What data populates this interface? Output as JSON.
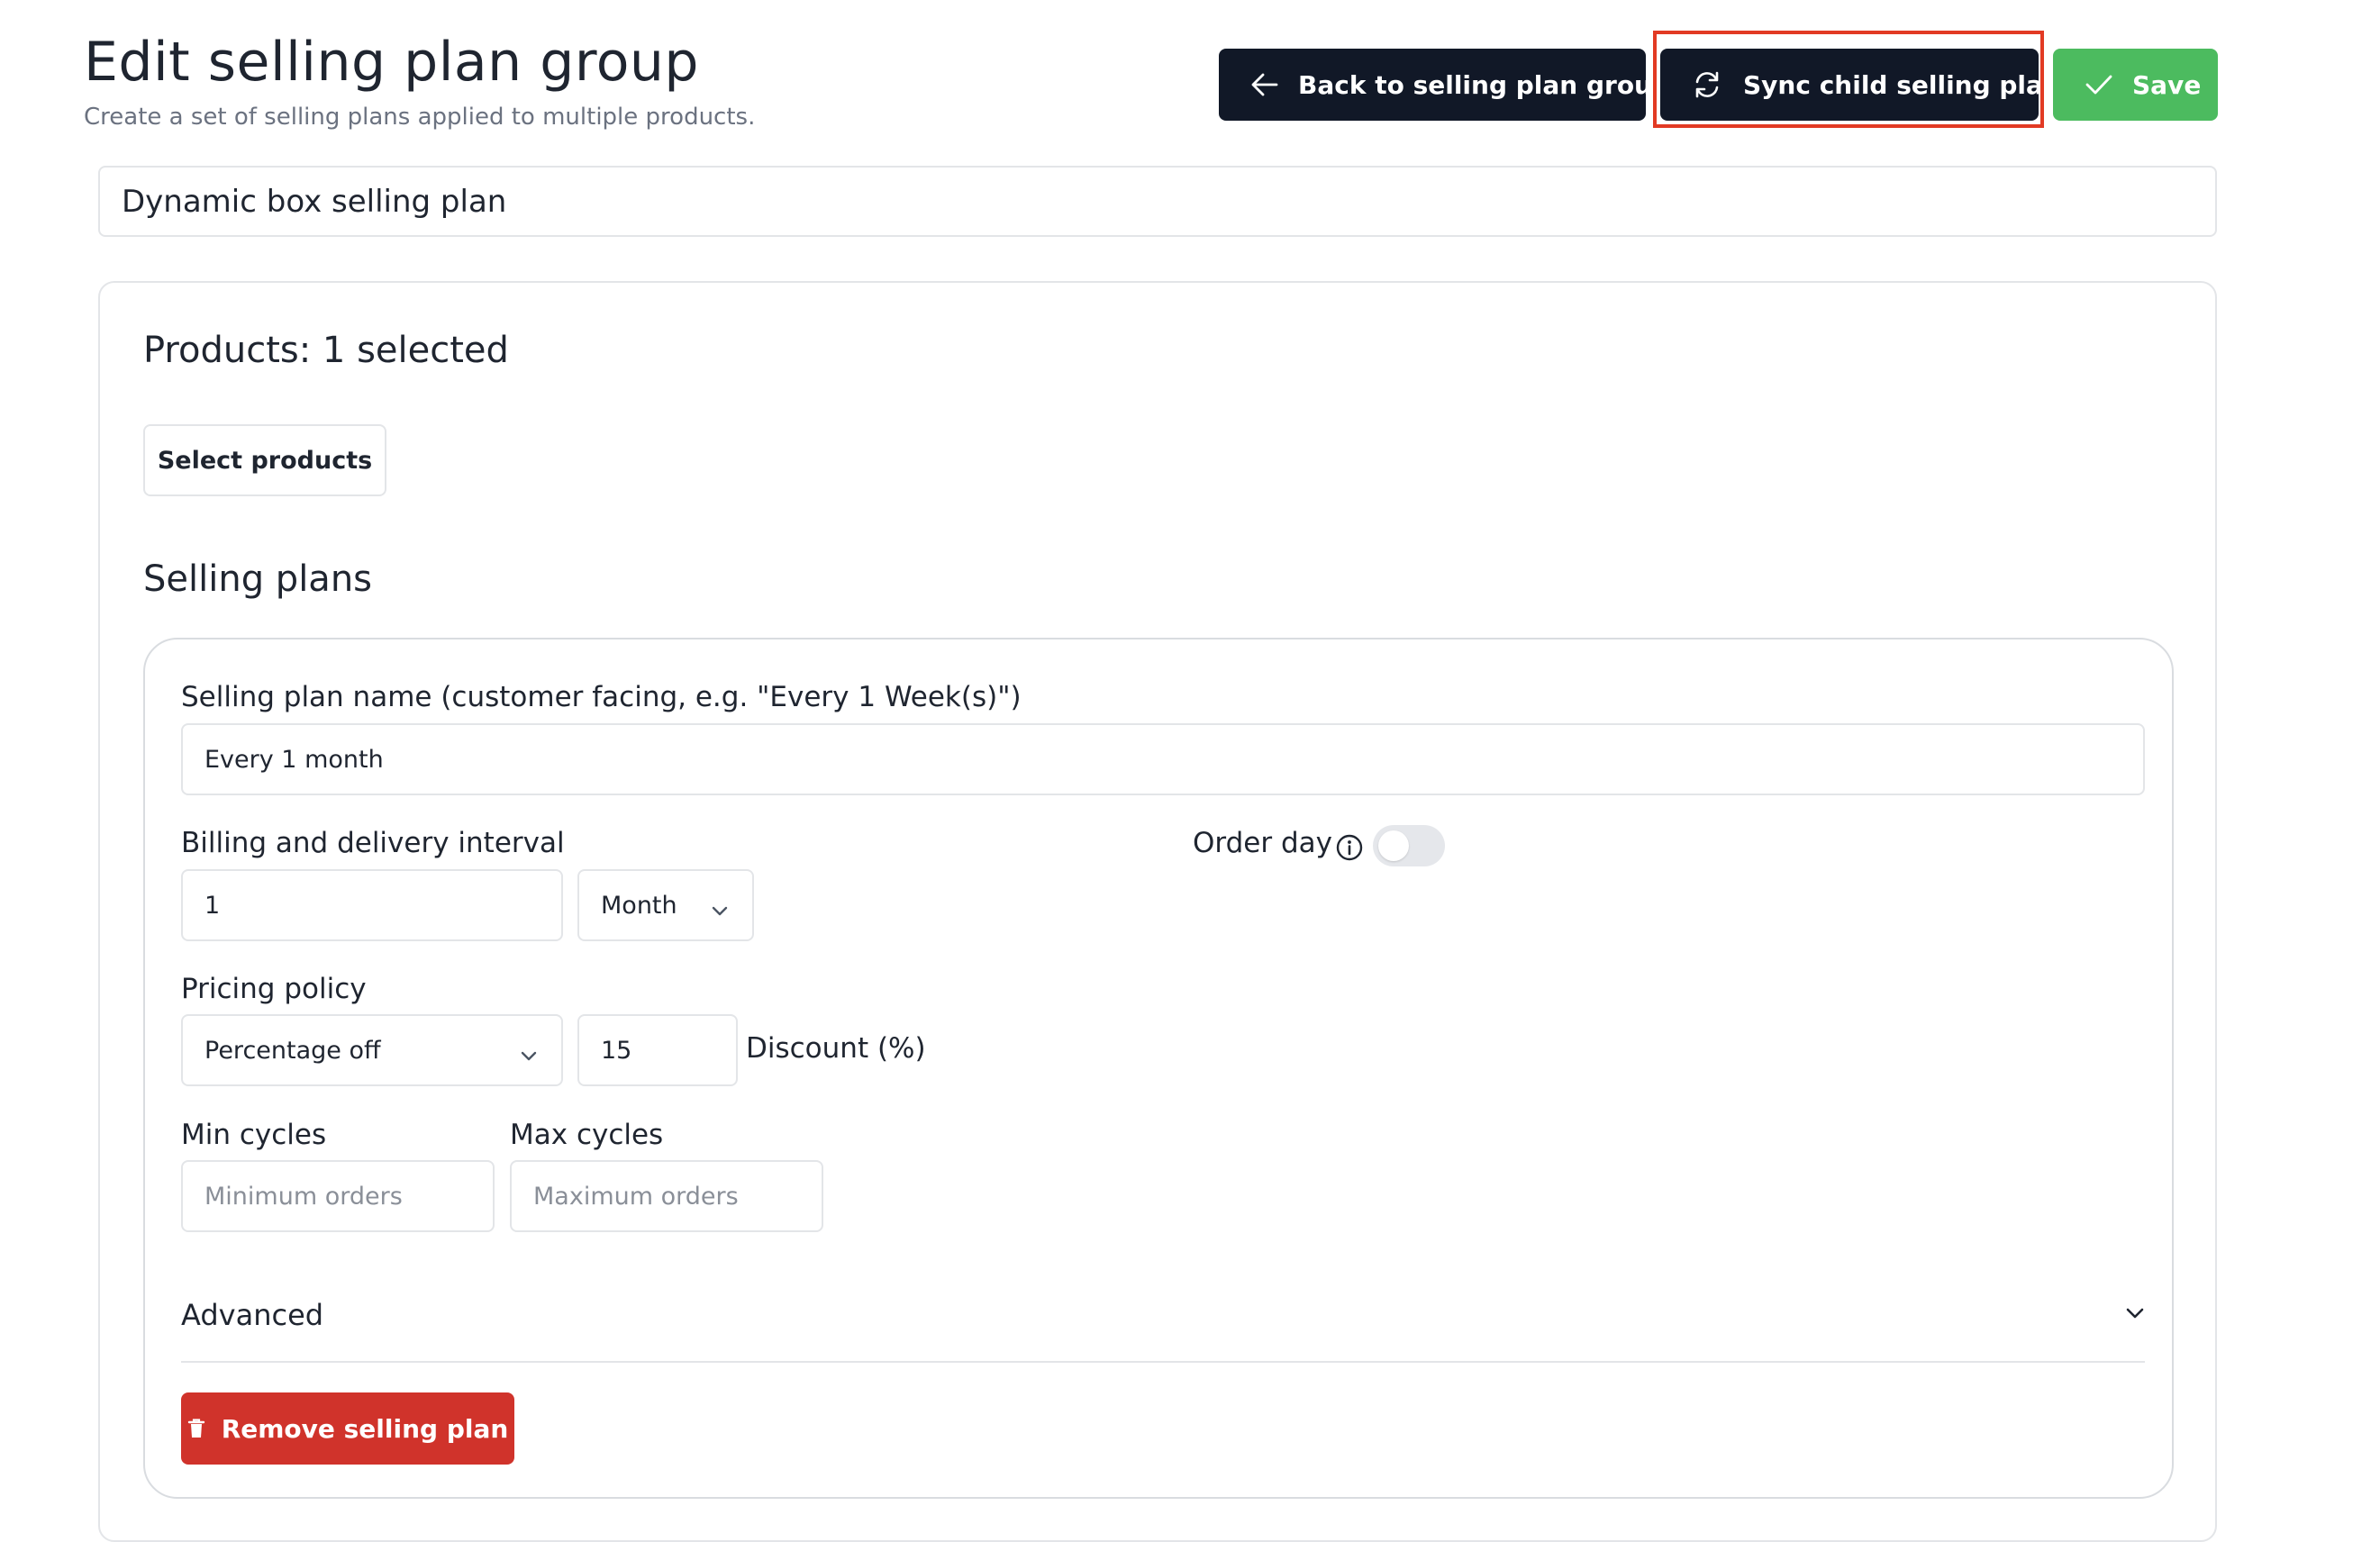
{
  "header": {
    "title": "Edit selling plan group",
    "subtitle": "Create a set of selling plans applied to multiple products.",
    "back_label": "Back to selling plan groups",
    "sync_label": "Sync child selling plans",
    "save_label": "Save"
  },
  "group": {
    "name_value": "Dynamic box selling plan"
  },
  "products": {
    "heading": "Products: 1 selected",
    "select_label": "Select products"
  },
  "selling_plans": {
    "heading": "Selling plans",
    "plan": {
      "name_label": "Selling plan name (customer facing, e.g. \"Every 1 Week(s)\")",
      "name_value": "Every 1 month",
      "interval_label": "Billing and delivery interval",
      "interval_value": "1",
      "interval_unit": "Month",
      "order_day_label": "Order day",
      "order_day_enabled": false,
      "pricing_label": "Pricing policy",
      "pricing_type": "Percentage off",
      "discount_value": "15",
      "discount_label": "Discount (%)",
      "min_cycles_label": "Min cycles",
      "min_cycles_placeholder": "Minimum orders",
      "max_cycles_label": "Max cycles",
      "max_cycles_placeholder": "Maximum orders",
      "advanced_label": "Advanced",
      "remove_label": "Remove selling plan"
    }
  },
  "colors": {
    "dark_button": "#111827",
    "save_button": "#4cbb5f",
    "remove_button": "#d0332b",
    "highlight": "#e23a24"
  },
  "icons": {
    "back": "arrow-left-icon",
    "sync": "sync-icon",
    "save": "check-icon",
    "info": "info-icon",
    "remove": "trash-icon",
    "dropdown": "chevron-down-icon"
  }
}
